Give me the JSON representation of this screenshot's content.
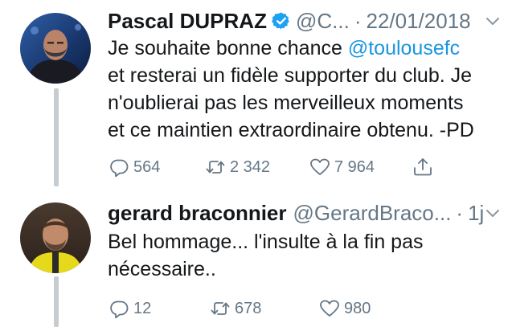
{
  "tweets": [
    {
      "author_name": "Pascal DUPRAZ",
      "handle": "@C...",
      "separator": "·",
      "date": "22/01/2018",
      "verified": true,
      "text_prefix": "Je souhaite bonne chance ",
      "mention": "@toulousefc",
      "text_suffix": "\net resterai un fidèle supporter du club. Je\nn'oublierai pas les merveilleux moments\net ce maintien extraordinaire obtenu. -PD",
      "replies": "564",
      "retweets": "2 342",
      "likes": "7 964",
      "icons": {
        "reply": "reply-icon",
        "retweet": "retweet-icon",
        "like": "like-icon",
        "share": "share-icon",
        "more": "chevron-down-icon"
      }
    },
    {
      "author_name": "gerard braconnier",
      "handle": "@GerardBraco...",
      "separator": "·",
      "date": "1j",
      "verified": false,
      "text": "Bel hommage... l'insulte à la fin pas\nnécessaire..",
      "replies": "12",
      "retweets": "678",
      "likes": "980",
      "icons": {
        "reply": "reply-icon",
        "retweet": "retweet-icon",
        "like": "like-icon",
        "more": "chevron-down-icon"
      }
    }
  ],
  "colors": {
    "text": "#14171a",
    "secondary": "#657786",
    "link": "#1b95e0",
    "verified": "#1da1f2",
    "thread_line": "#c7ccd1"
  }
}
